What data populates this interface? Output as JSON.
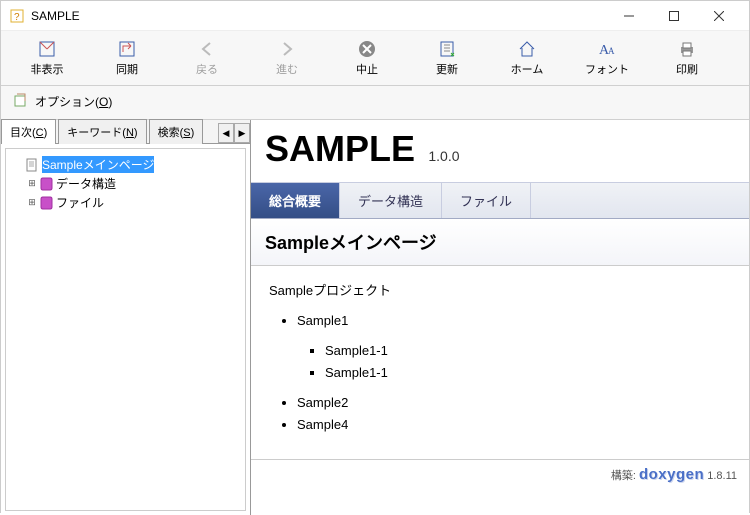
{
  "window": {
    "title": "SAMPLE"
  },
  "toolbar": [
    {
      "id": "hide",
      "label": "非表示",
      "icon": "hide",
      "enabled": true
    },
    {
      "id": "sync",
      "label": "同期",
      "icon": "sync",
      "enabled": true
    },
    {
      "id": "back",
      "label": "戻る",
      "icon": "back",
      "enabled": false
    },
    {
      "id": "forward",
      "label": "進む",
      "icon": "forward",
      "enabled": false
    },
    {
      "id": "stop",
      "label": "中止",
      "icon": "stop",
      "enabled": true
    },
    {
      "id": "refresh",
      "label": "更新",
      "icon": "refresh",
      "enabled": true
    },
    {
      "id": "home",
      "label": "ホーム",
      "icon": "home",
      "enabled": true
    },
    {
      "id": "font",
      "label": "フォント",
      "icon": "font",
      "enabled": true
    },
    {
      "id": "print",
      "label": "印刷",
      "icon": "print",
      "enabled": true
    }
  ],
  "toolbar2": {
    "options": {
      "label": "オプション(",
      "hotkey": "O",
      "suffix": ")"
    }
  },
  "nav": {
    "tabs": [
      {
        "label": "目次(",
        "hotkey": "C",
        "suffix": ")",
        "active": true
      },
      {
        "label": "キーワード(",
        "hotkey": "N",
        "suffix": ")",
        "active": false
      },
      {
        "label": "検索(",
        "hotkey": "S",
        "suffix": ")",
        "active": false
      }
    ]
  },
  "tree": [
    {
      "label": "Sampleメインページ",
      "icon": "page",
      "selected": true,
      "expandable": false
    },
    {
      "label": "データ構造",
      "icon": "book",
      "selected": false,
      "expandable": true
    },
    {
      "label": "ファイル",
      "icon": "book",
      "selected": false,
      "expandable": true
    }
  ],
  "doc": {
    "title": "SAMPLE",
    "version": "1.0.0",
    "tabs": [
      {
        "label": "総合概要",
        "active": true
      },
      {
        "label": "データ構造",
        "active": false
      },
      {
        "label": "ファイル",
        "active": false
      }
    ],
    "page_title": "Sampleメインページ",
    "intro": "Sampleプロジェクト",
    "items": [
      {
        "label": "Sample1",
        "children": [
          "Sample1-1",
          "Sample1-1"
        ]
      },
      {
        "label": "Sample2"
      },
      {
        "label": "Sample4"
      }
    ],
    "footer": {
      "prefix": "構築: ",
      "brand": "doxygen",
      "version": "1.8.11"
    }
  }
}
